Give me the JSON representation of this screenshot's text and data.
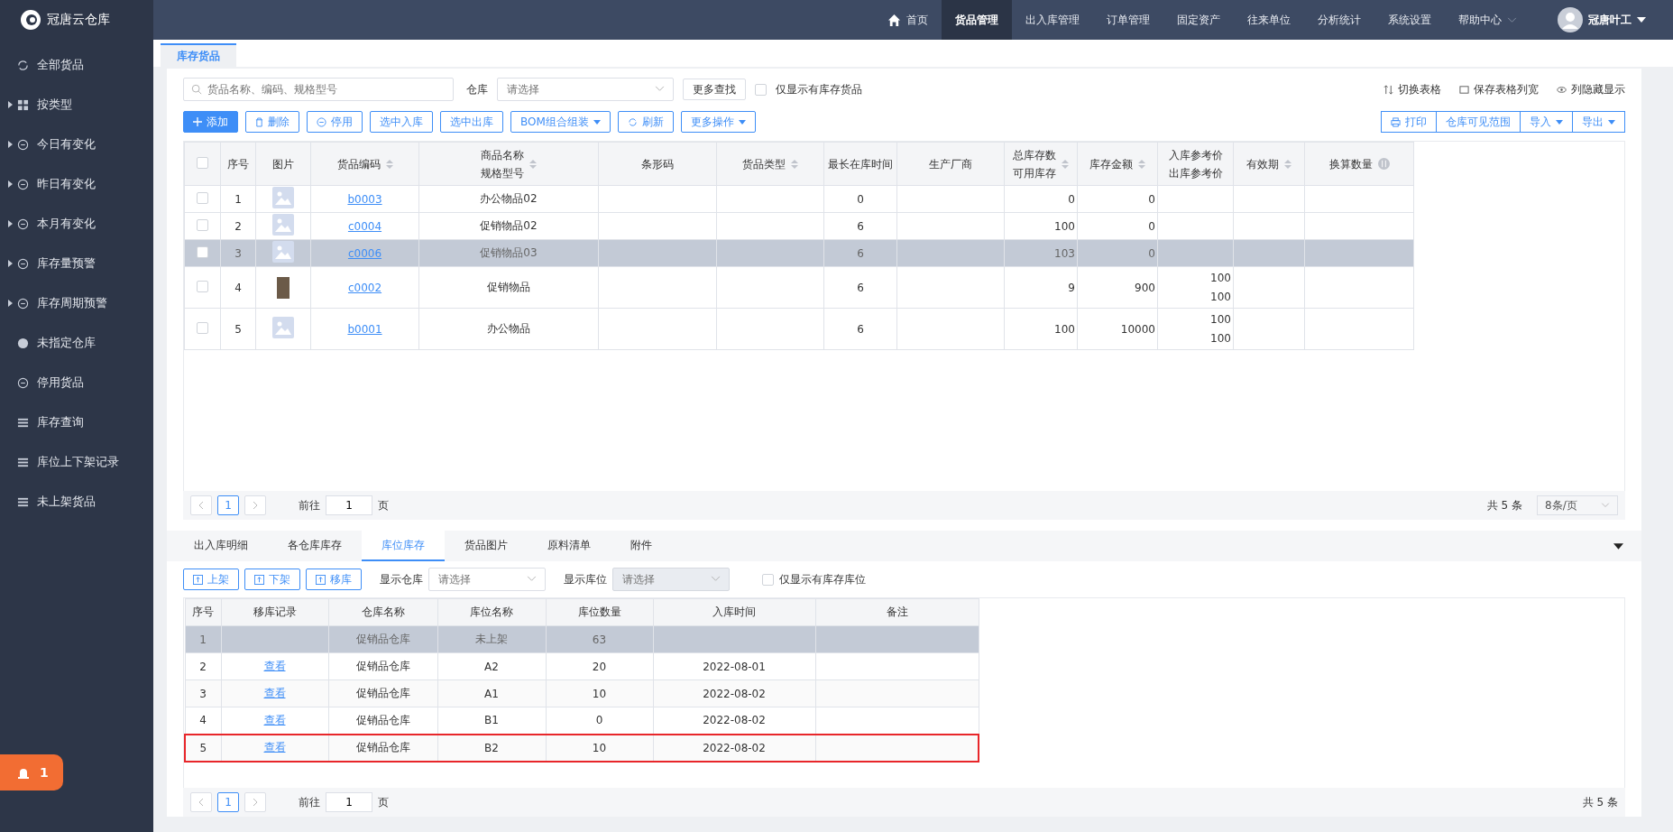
{
  "app": {
    "title": "冠唐云仓库"
  },
  "nav": [
    {
      "label": "首页",
      "selected": false
    },
    {
      "label": "货品管理",
      "selected": true
    },
    {
      "label": "出入库管理",
      "selected": false
    },
    {
      "label": "订单管理",
      "selected": false
    },
    {
      "label": "固定资产",
      "selected": false
    },
    {
      "label": "往来单位",
      "selected": false
    },
    {
      "label": "分析统计",
      "selected": false
    },
    {
      "label": "系统设置",
      "selected": false
    },
    {
      "label": "帮助中心",
      "selected": false,
      "dropdown": true
    }
  ],
  "user": {
    "name": "冠唐叶工"
  },
  "sidebar": {
    "items": [
      {
        "label": "全部货品",
        "expandable": false
      },
      {
        "label": "按类型",
        "expandable": true
      },
      {
        "label": "今日有变化",
        "expandable": true
      },
      {
        "label": "昨日有变化",
        "expandable": true
      },
      {
        "label": "本月有变化",
        "expandable": true
      },
      {
        "label": "库存量预警",
        "expandable": true
      },
      {
        "label": "库存周期预警",
        "expandable": true
      },
      {
        "label": "未指定仓库",
        "expandable": false
      },
      {
        "label": "停用货品",
        "expandable": false
      },
      {
        "label": "库存查询",
        "expandable": false
      },
      {
        "label": "库位上下架记录",
        "expandable": false
      },
      {
        "label": "未上架货品",
        "expandable": false
      }
    ],
    "alarm_count": "1"
  },
  "page_tabs": [
    {
      "label": "库存货品",
      "selected": true
    }
  ],
  "filters": {
    "search_placeholder": "货品名称、编码、规格型号",
    "warehouse_label": "仓库",
    "warehouse_placeholder": "请选择",
    "more_search": "更多查找",
    "in_stock_only": {
      "label": "仅显示有库存货品",
      "checked": false
    }
  },
  "view_links": [
    "切换表格",
    "保存表格列宽",
    "列隐藏显示"
  ],
  "toolbar": [
    {
      "label": "添加",
      "kind": "primary",
      "dropdown": false
    },
    {
      "label": "删除",
      "kind": "default",
      "dropdown": false
    },
    {
      "label": "停用",
      "kind": "default",
      "dropdown": false
    },
    {
      "label": "选中入库",
      "kind": "default",
      "dropdown": false
    },
    {
      "label": "选中出库",
      "kind": "default",
      "dropdown": false
    },
    {
      "label": "BOM组合组装",
      "kind": "default",
      "dropdown": true
    },
    {
      "label": "刷新",
      "kind": "default",
      "dropdown": false
    },
    {
      "label": "更多操作",
      "kind": "default",
      "dropdown": true
    }
  ],
  "right_buttons": [
    {
      "label": "打印",
      "dropdown": false
    },
    {
      "label": "仓库可见范围",
      "dropdown": false
    },
    {
      "label": "导入",
      "dropdown": true
    },
    {
      "label": "导出",
      "dropdown": true
    }
  ],
  "goods_table": {
    "all_checked": false,
    "columns": [
      {
        "label": "序号",
        "sortable": false
      },
      {
        "label": "图片",
        "sortable": false
      },
      {
        "label": "货品编码",
        "sortable": true
      },
      {
        "label": "商品名称",
        "label2": "规格型号",
        "sortable": true
      },
      {
        "label": "条形码",
        "sortable": false
      },
      {
        "label": "货品类型",
        "sortable": true
      },
      {
        "label": "最长在库时间",
        "sortable": false
      },
      {
        "label": "生产厂商",
        "sortable": false
      },
      {
        "label": "总库存数",
        "label2": "可用库存",
        "sortable": true
      },
      {
        "label": "库存金额",
        "sortable": true
      },
      {
        "label": "入库参考价",
        "label2": "出库参考价",
        "sortable": false
      },
      {
        "label": "有效期",
        "sortable": true
      },
      {
        "label": "换算数量",
        "sortable": false,
        "info": true
      }
    ],
    "rows": [
      {
        "index": "1",
        "kind": "placeholder",
        "code": "b0003",
        "name": "办公物品02",
        "max_days": "0",
        "total_stock": "0",
        "stock_amount": "0",
        "selected": false,
        "checked": false
      },
      {
        "index": "2",
        "kind": "placeholder",
        "code": "c0004",
        "name": "促销物品02",
        "max_days": "6",
        "total_stock": "100",
        "stock_amount": "0",
        "selected": false,
        "checked": false
      },
      {
        "index": "3",
        "kind": "placeholder",
        "code": "c0006",
        "name": "促销物品03",
        "max_days": "6",
        "total_stock": "103",
        "stock_amount": "0",
        "selected": true,
        "checked": false
      },
      {
        "index": "4",
        "kind": "photo",
        "code": "c0002",
        "name": "促销物品",
        "max_days": "6",
        "total_stock": "9",
        "stock_amount": "900",
        "in_price": "100",
        "out_price": "100",
        "selected": false,
        "checked": false
      },
      {
        "index": "5",
        "kind": "placeholder",
        "code": "b0001",
        "name": "办公物品",
        "max_days": "6",
        "total_stock": "100",
        "stock_amount": "10000",
        "in_price": "100",
        "out_price": "100",
        "selected": false,
        "checked": false
      }
    ]
  },
  "goods_pager": {
    "pages": [
      {
        "label": "1",
        "selected": true
      }
    ],
    "goto_label": "前往",
    "goto_value": "1",
    "goto_suffix": "页",
    "total": "共 5 条",
    "page_size": "8条/页"
  },
  "detail_tabs": [
    {
      "label": "出入库明细",
      "selected": false
    },
    {
      "label": "各仓库库存",
      "selected": false
    },
    {
      "label": "库位库存",
      "selected": true
    },
    {
      "label": "货品图片",
      "selected": false
    },
    {
      "label": "原料清单",
      "selected": false
    },
    {
      "label": "附件",
      "selected": false
    }
  ],
  "detail_toolbar": {
    "buttons": [
      "上架",
      "下架",
      "移库"
    ],
    "warehouse_label": "显示仓库",
    "warehouse_placeholder": "请选择",
    "location_label": "显示库位",
    "location_placeholder": "请选择",
    "location_disabled": true,
    "in_stock_only": {
      "label": "仅显示有库存库位",
      "checked": false
    }
  },
  "location_table": {
    "columns": [
      "序号",
      "移库记录",
      "仓库名称",
      "库位名称",
      "库位数量",
      "入库时间",
      "备注"
    ],
    "rows": [
      {
        "index": "1",
        "warehouse": "促销品仓库",
        "location": "未上架",
        "quantity": "63",
        "selected": true,
        "highlighted": false
      },
      {
        "index": "2",
        "record": "查看",
        "warehouse": "促销品仓库",
        "location": "A2",
        "quantity": "20",
        "date": "2022-08-01",
        "selected": false,
        "highlighted": false
      },
      {
        "index": "3",
        "record": "查看",
        "warehouse": "促销品仓库",
        "location": "A1",
        "quantity": "10",
        "date": "2022-08-02",
        "selected": false,
        "highlighted": false
      },
      {
        "index": "4",
        "record": "查看",
        "warehouse": "促销品仓库",
        "location": "B1",
        "quantity": "0",
        "date": "2022-08-02",
        "selected": false,
        "highlighted": false
      },
      {
        "index": "5",
        "record": "查看",
        "warehouse": "促销品仓库",
        "location": "B2",
        "quantity": "10",
        "date": "2022-08-02",
        "selected": false,
        "highlighted": true
      }
    ]
  },
  "detail_pager": {
    "pages": [
      {
        "label": "1",
        "selected": true
      }
    ],
    "goto_label": "前往",
    "goto_value": "1",
    "goto_suffix": "页",
    "total": "共 5 条"
  }
}
